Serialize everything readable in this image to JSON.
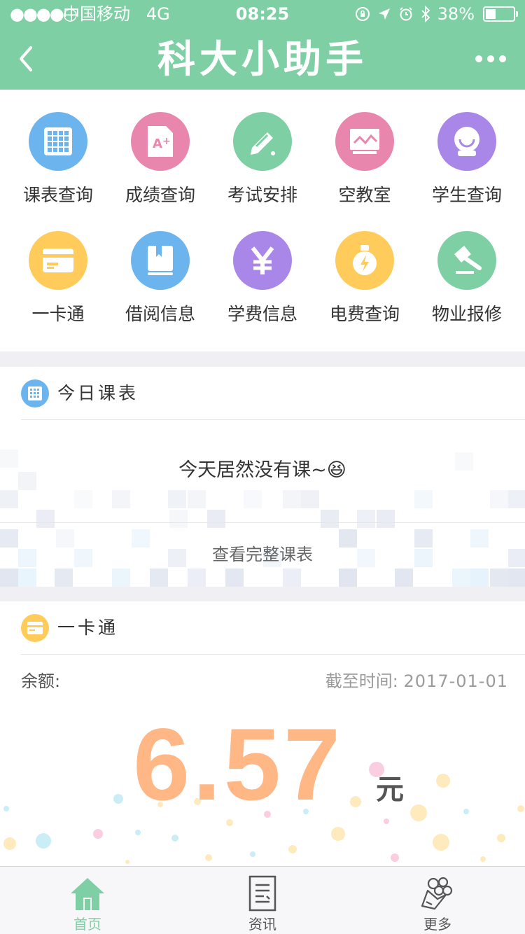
{
  "status_bar": {
    "signal": "●●●●○",
    "carrier": "中国移动",
    "network": "4G",
    "time": "08:25",
    "battery_percent": "38%",
    "battery_level": 0.38
  },
  "nav": {
    "title": "科大小助手",
    "back_icon": "chevron-left-icon",
    "more_icon": "more-dots-icon"
  },
  "colors": {
    "primary": "#7ed0a4",
    "blue": "#6cb4ee",
    "pink": "#e986ae",
    "green": "#7ed0a4",
    "purple": "#a887e8",
    "yellow": "#ffcc5c",
    "amount": "#ffb785",
    "separator": "#efeff4"
  },
  "features": [
    {
      "label": "课表查询",
      "icon": "calendar-grid-icon",
      "color": "#6cb4ee"
    },
    {
      "label": "成绩查询",
      "icon": "grade-document-icon",
      "color": "#e986ae"
    },
    {
      "label": "考试安排",
      "icon": "pencil-icon",
      "color": "#7ed0a4"
    },
    {
      "label": "空教室",
      "icon": "blackboard-icon",
      "color": "#e986ae"
    },
    {
      "label": "学生查询",
      "icon": "student-avatar-icon",
      "color": "#a887e8"
    },
    {
      "label": "一卡通",
      "icon": "card-icon",
      "color": "#ffcc5c"
    },
    {
      "label": "借阅信息",
      "icon": "book-icon",
      "color": "#6cb4ee"
    },
    {
      "label": "学费信息",
      "icon": "yuan-icon",
      "color": "#a887e8"
    },
    {
      "label": "电费查询",
      "icon": "lightbulb-icon",
      "color": "#ffcc5c"
    },
    {
      "label": "物业报修",
      "icon": "hammer-icon",
      "color": "#7ed0a4"
    }
  ],
  "timetable": {
    "title": "今日课表",
    "icon": "calendar-grid-icon",
    "empty_message": "今天居然没有课~😆",
    "view_full": "查看完整课表"
  },
  "card": {
    "title": "一卡通",
    "icon": "card-icon",
    "balance_label": "余额:",
    "as_of_label": "截至时间:",
    "as_of_date": "2017-01-01",
    "amount": "6.57",
    "unit": "元"
  },
  "tabs": [
    {
      "label": "首页",
      "icon": "home-icon",
      "active": true
    },
    {
      "label": "资讯",
      "icon": "news-document-icon",
      "active": false
    },
    {
      "label": "更多",
      "icon": "bouquet-icon",
      "active": false
    }
  ]
}
